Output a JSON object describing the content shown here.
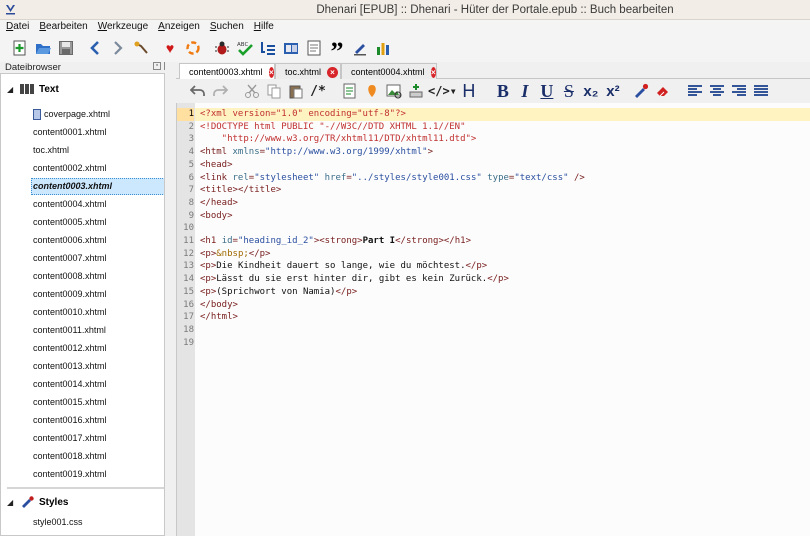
{
  "window": {
    "title": "Dhenari [EPUB] :: Dhenari - Hüter der Portale.epub :: Buch bearbeiten",
    "app_icon": "sigil-icon"
  },
  "menu": [
    "Datei",
    "Bearbeiten",
    "Werkzeuge",
    "Anzeigen",
    "Suchen",
    "Hilfe"
  ],
  "toolbar_icons": [
    "add-file-icon",
    "open-icon",
    "save-icon",
    "back-icon",
    "forward-icon",
    "tools-icon",
    "heart-icon",
    "target-icon",
    "bug-icon",
    "spellcheck-icon",
    "sort-icon",
    "meta-icon",
    "toc-icon",
    "quote-icon",
    "edit-icon",
    "report-icon"
  ],
  "file_browser": {
    "title": "Dateibrowser",
    "text_group": "Text",
    "files": [
      "coverpage.xhtml",
      "content0001.xhtml",
      "toc.xhtml",
      "content0002.xhtml",
      "content0003.xhtml",
      "content0004.xhtml",
      "content0005.xhtml",
      "content0006.xhtml",
      "content0007.xhtml",
      "content0008.xhtml",
      "content0009.xhtml",
      "content0010.xhtml",
      "content0011.xhtml",
      "content0012.xhtml",
      "content0013.xhtml",
      "content0014.xhtml",
      "content0015.xhtml",
      "content0016.xhtml",
      "content0017.xhtml",
      "content0018.xhtml",
      "content0019.xhtml"
    ],
    "selected_file": "content0003.xhtml",
    "styles_group": "Styles",
    "style_files": [
      "style001.css"
    ]
  },
  "tabs": [
    {
      "label": "content0003.xhtml",
      "active": true
    },
    {
      "label": "toc.xhtml",
      "active": false
    },
    {
      "label": "content0004.xhtml",
      "active": false
    }
  ],
  "editor_toolbar": {
    "heading": "H",
    "bold": "B",
    "italic": "I",
    "underline": "U",
    "strike": "S",
    "subscript": "x₂",
    "superscript": "x²"
  },
  "editor": {
    "current_line": 1,
    "line_count": 19,
    "lines": [
      "<?xml version=\"1.0\" encoding=\"utf-8\"?>",
      "<!DOCTYPE html PUBLIC \"-//W3C//DTD XHTML 1.1//EN\"",
      "    \"http://www.w3.org/TR/xhtml11/DTD/xhtml11.dtd\">",
      "<html xmlns=\"http://www.w3.org/1999/xhtml\">",
      "<head>",
      "<link rel=\"stylesheet\" href=\"../styles/style001.css\" type=\"text/css\" />",
      "<title></title>",
      "</head>",
      "<body>",
      "",
      "<h1 id=\"heading_id_2\"><strong>Part I</strong></h1>",
      "<p>&nbsp;</p>",
      "<p>Die Kindheit dauert so lange, wie du möchtest.</p>",
      "<p>Lässt du sie erst hinter dir, gibt es kein Zurück.</p>",
      "<p>(Sprichwort von Namia)</p>",
      "</body>",
      "</html>",
      "",
      ""
    ]
  }
}
